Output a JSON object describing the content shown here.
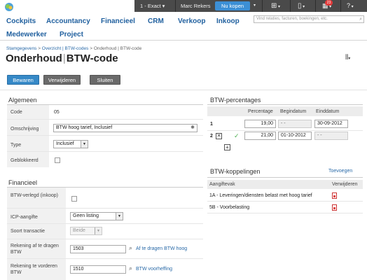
{
  "topbar": {
    "company": "1 - Exact",
    "user": "Marc Rekers",
    "buy_now": "Nu kopen",
    "notification_count": "23",
    "add_icon": "plus-icon",
    "doc_icon": "document-icon",
    "help_icon": "help-icon"
  },
  "nav": {
    "items": [
      "Cockpits",
      "Accountancy",
      "Financieel",
      "CRM",
      "Verkoop",
      "Inkoop",
      "Medewerker",
      "Project"
    ],
    "search_placeholder": "Vind relaties, facturen, boekingen, etc."
  },
  "breadcrumb": {
    "path": [
      "Stamgegevens",
      "Overzicht | BTW-codes"
    ],
    "current": "Onderhoud | BTW-code",
    "separator": ">"
  },
  "page": {
    "title_a": "Onderhoud",
    "title_sep": "|",
    "title_b": "BTW-code"
  },
  "toolbar": {
    "save": "Bewaren",
    "delete": "Verwijderen",
    "close": "Sluiten"
  },
  "algemeen": {
    "title": "Algemeen",
    "code_label": "Code",
    "code_value": "05",
    "omschrijving_label": "Omschrijving",
    "omschrijving_value": "BTW hoog tarief, Inclusief",
    "type_label": "Type",
    "type_value": "Inclusief",
    "geblokkeerd_label": "Geblokkeerd"
  },
  "financieel": {
    "title": "Financieel",
    "verlegd_label": "BTW-verlegd (inkoop)",
    "icp_label": "ICP-aangifte",
    "icp_value": "Geen listing",
    "soort_label": "Soort transactie",
    "soort_value": "Beide",
    "afdragen_label": "Rekening af te dragen BTW",
    "afdragen_value": "1503",
    "afdragen_link": "Af te dragen BTW hoog",
    "vorderen_label": "Rekening te vorderen BTW",
    "vorderen_value": "1510",
    "vorderen_link": "BTW voorheffing"
  },
  "percentages": {
    "title": "BTW-percentages",
    "headers": [
      "Percentage",
      "Begindatum",
      "Einddatum"
    ],
    "rows": [
      {
        "num": "1",
        "percentage": "19,00",
        "begin": "- -",
        "end": "30-09-2012"
      },
      {
        "num": "2",
        "percentage": "21,00",
        "begin": "01-10-2012",
        "end": "- -"
      }
    ]
  },
  "koppelingen": {
    "title": "BTW-koppelingen",
    "add_link": "Toevoegen",
    "headers": [
      "Aangiftevak",
      "Verwijderen"
    ],
    "rows": [
      "1A - Leveringen/diensten belast met hoog tarief",
      "5B - Voorbelasting"
    ]
  }
}
